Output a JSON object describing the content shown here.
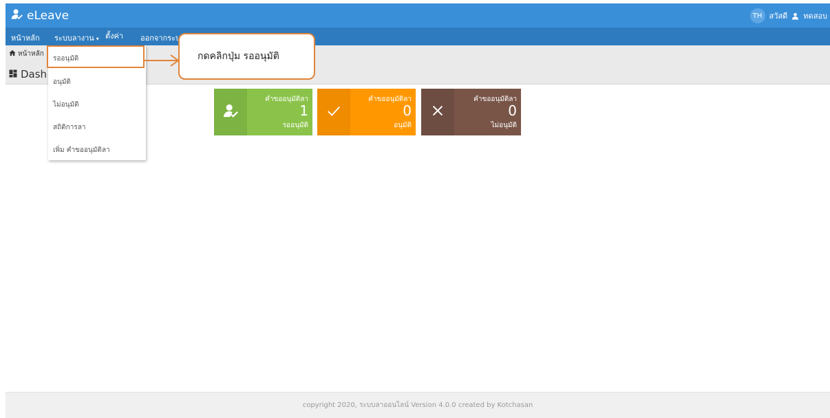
{
  "app": {
    "brand": "eLeave"
  },
  "user": {
    "lang": "TH",
    "greeting": "สวัสดี",
    "name": "ทดสอบ"
  },
  "menu": {
    "home": "หน้าหลัก",
    "leave_system": "ระบบลางาน",
    "settings": "ตั้งค่า",
    "logout": "ออกจากระบบ"
  },
  "breadcrumb": {
    "home": "หน้าหลัก"
  },
  "page_title": "Dash",
  "dropdown": {
    "items": [
      "รออนุมัติ",
      "อนุมัติ",
      "ไม่อนุมัติ",
      "สถิติการลา",
      "เพิ่ม คำขออนุมัติลา"
    ]
  },
  "callout": {
    "text": "กดคลิกปุ่ม รออนุมัติ",
    "color": "#e0843a"
  },
  "cards": [
    {
      "title": "คำขออนุมัติลา",
      "count": "1",
      "sub": "รออนุมัติ",
      "icon": "user-check-icon",
      "color_main": "#8bc34a",
      "color_icon": "#7cb342"
    },
    {
      "title": "คำขออนุมัติลา",
      "count": "0",
      "sub": "อนุมัติ",
      "icon": "check-icon",
      "color_main": "#ff9800",
      "color_icon": "#f08c00"
    },
    {
      "title": "คำขออนุมัติลา",
      "count": "0",
      "sub": "ไม่อนุมัติ",
      "icon": "close-icon",
      "color_main": "#795548",
      "color_icon": "#6d4c41"
    }
  ],
  "footer": {
    "text": "copyright 2020, ระบบลาออนไลน์ Version 4.0.0 created by Kotchasan"
  },
  "colors": {
    "topbar": "#3a8fd9",
    "menubar": "#2e7cbf"
  }
}
